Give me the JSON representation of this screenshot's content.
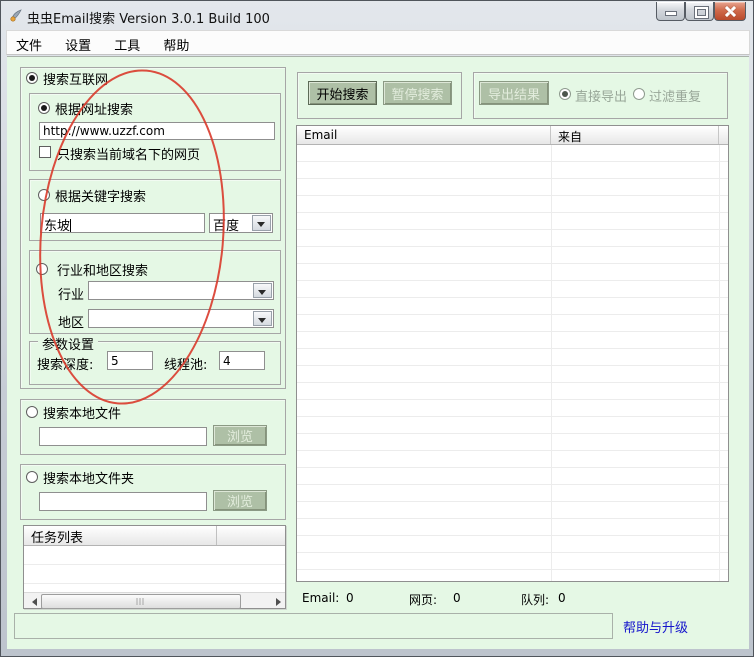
{
  "window": {
    "title": "虫虫Email搜索 Version 3.0.1 Build 100"
  },
  "menu": {
    "items": [
      "文件",
      "设置",
      "工具",
      "帮助"
    ]
  },
  "left": {
    "internet": {
      "label": "搜索互联网"
    },
    "url": {
      "label": "根据网址搜索",
      "value": "http://www.uzzf.com",
      "checkbox_label": "只搜索当前域名下的网页"
    },
    "keyword": {
      "label": "根据关键字搜索",
      "value": "东坡",
      "engine": "百度"
    },
    "industry": {
      "label": "行业和地区搜索",
      "industry_label": "行业",
      "region_label": "地区"
    },
    "params": {
      "label": "参数设置",
      "depth_label": "搜索深度:",
      "depth_value": "5",
      "threads_label": "线程池:",
      "threads_value": "4"
    },
    "local_file": {
      "label": "搜索本地文件",
      "browse_label": "浏览",
      "path": ""
    },
    "local_folder": {
      "label": "搜索本地文件夹",
      "browse_label": "浏览",
      "path": ""
    },
    "tasks": {
      "header": "任务列表"
    }
  },
  "right": {
    "toolbar": {
      "start": "开始搜索",
      "pause": "暂停搜索"
    },
    "export": {
      "button": "导出结果",
      "direct": "直接导出",
      "filter": "过滤重复"
    },
    "table": {
      "columns": [
        "Email",
        "来自"
      ]
    },
    "status": {
      "email_label": "Email:",
      "email_value": "0",
      "pages_label": "网页:",
      "pages_value": "0",
      "queue_label": "队列:",
      "queue_value": "0"
    },
    "help_link": "帮助与升级"
  },
  "colors": {
    "client_bg": "#e5f8e5",
    "button_bg": "#aec0a6",
    "link": "#1515cc",
    "annotation_red": "#d93a2b",
    "close_button": "#c9573c"
  }
}
